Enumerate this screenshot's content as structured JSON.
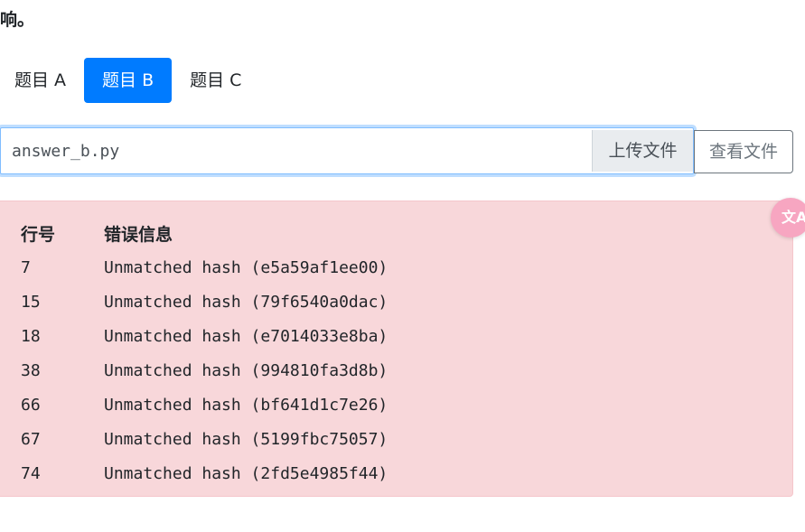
{
  "intro_text": "响。",
  "tabs": [
    {
      "label": "题目 A",
      "active": false
    },
    {
      "label": "题目 B",
      "active": true
    },
    {
      "label": "题目 C",
      "active": false
    }
  ],
  "upload": {
    "file_name": "answer_b.py",
    "upload_label": "上传文件",
    "view_label": "查看文件"
  },
  "errors": {
    "headers": {
      "line": "行号",
      "message": "错误信息"
    },
    "rows": [
      {
        "line": "7",
        "message": "Unmatched hash (e5a59af1ee00)"
      },
      {
        "line": "15",
        "message": "Unmatched hash (79f6540a0dac)"
      },
      {
        "line": "18",
        "message": "Unmatched hash (e7014033e8ba)"
      },
      {
        "line": "38",
        "message": "Unmatched hash (994810fa3d8b)"
      },
      {
        "line": "66",
        "message": "Unmatched hash (bf641d1c7e26)"
      },
      {
        "line": "67",
        "message": "Unmatched hash (5199fbc75057)"
      },
      {
        "line": "74",
        "message": "Unmatched hash (2fd5e4985f44)"
      }
    ]
  },
  "colors": {
    "accent": "#007bff",
    "error_bg": "#f8d7da",
    "translate_button": "#f7a6c1"
  },
  "translate_widget": {
    "icon": "translate-icon",
    "glyph": "文A"
  }
}
